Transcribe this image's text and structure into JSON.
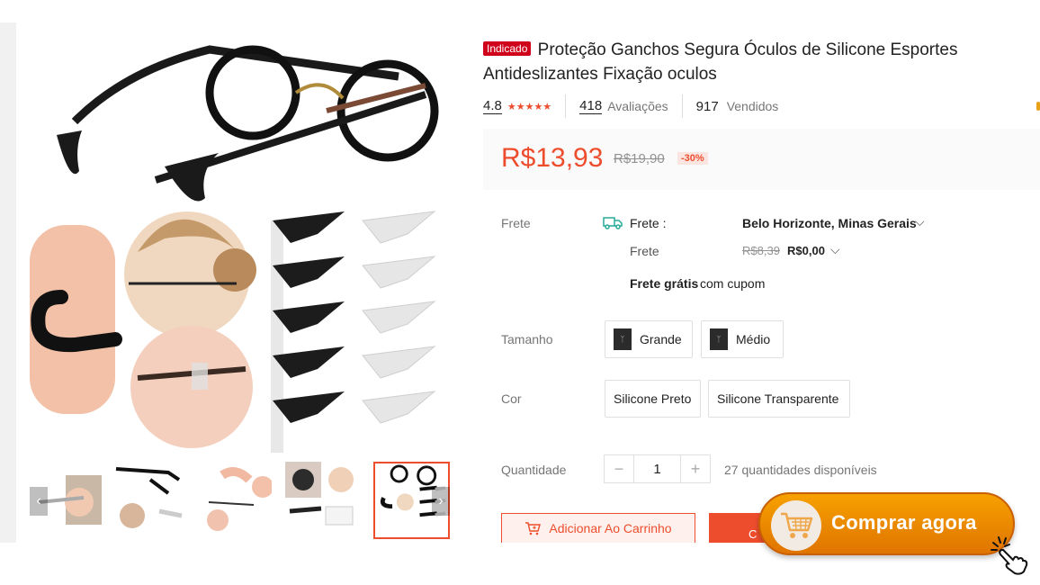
{
  "product": {
    "badge": "Indicado",
    "title": "Proteção Ganchos Segura Óculos de Silicone Esportes Antideslizantes Fixação oculos"
  },
  "ratings": {
    "score": "4.8",
    "stars": "★★★★★",
    "reviews_count": "418",
    "reviews_label": "Avaliações",
    "sold_count": "917",
    "sold_label": "Vendidos"
  },
  "price": {
    "current": "R$13,93",
    "original": "R$19,90",
    "discount": "-30%"
  },
  "shipping": {
    "label": "Frete",
    "to_label": "Frete :",
    "location": "Belo Horizonte, Minas Gerais",
    "cost_label": "Frete",
    "cost_original": "R$8,39",
    "cost_current": "R$0,00",
    "free_bold": "Frete grátis",
    "free_rest": "com cupom"
  },
  "size": {
    "label": "Tamanho",
    "options": [
      "Grande",
      "Médio"
    ]
  },
  "color": {
    "label": "Cor",
    "options": [
      "Silicone Preto",
      "Silicone Transparente"
    ]
  },
  "quantity": {
    "label": "Quantidade",
    "minus": "−",
    "value": "1",
    "plus": "+",
    "available": "27 quantidades disponíveis"
  },
  "actions": {
    "add_to_cart": "Adicionar Ao Carrinho",
    "buy_now_partial": "C"
  },
  "cta": {
    "label": "Comprar agora"
  },
  "gallery": {
    "prev": "‹",
    "next": "›"
  },
  "colors": {
    "accent": "#ee4d2d",
    "badge": "#d0011b",
    "cta": "#f39200"
  }
}
